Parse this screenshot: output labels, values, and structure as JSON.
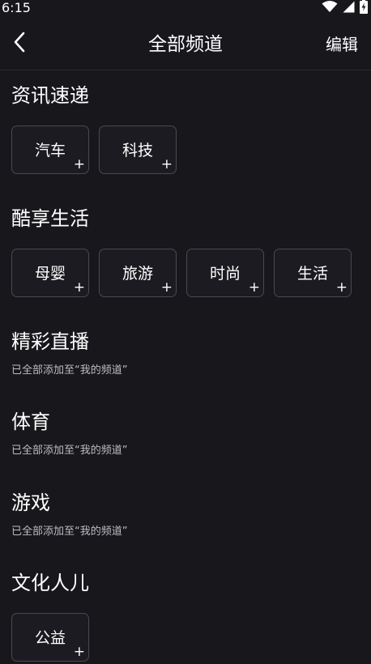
{
  "status_bar": {
    "time": "6:15",
    "icons": [
      "wifi-icon",
      "cell-signal-icon",
      "battery-charging-icon"
    ]
  },
  "header": {
    "title": "全部频道",
    "edit_label": "编辑"
  },
  "sections": [
    {
      "title": "资讯速递",
      "channels": [
        "汽车",
        "科技"
      ]
    },
    {
      "title": "酷享生活",
      "channels": [
        "母婴",
        "旅游",
        "时尚",
        "生活"
      ]
    },
    {
      "title": "精彩直播",
      "note": "已全部添加至“我的频道”"
    },
    {
      "title": "体育",
      "note": "已全部添加至“我的频道”"
    },
    {
      "title": "游戏",
      "note": "已全部添加至“我的频道”"
    },
    {
      "title": "文化人儿",
      "channels": [
        "公益"
      ]
    }
  ],
  "add_symbol": "+",
  "colors": {
    "background": "#18171c",
    "chip_border": "#4a4950",
    "text": "#ffffff",
    "note_text": "#bdbcc2"
  }
}
